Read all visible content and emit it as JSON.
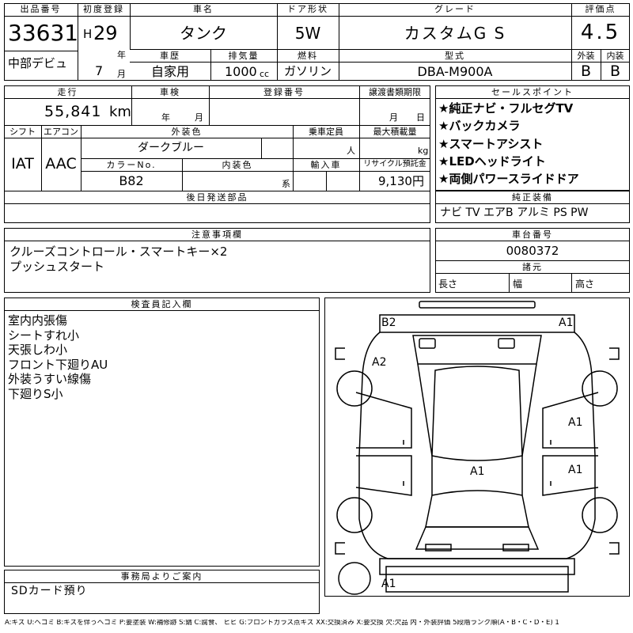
{
  "header": {
    "lot_label": "出品番号",
    "lot_no": "33631",
    "venue": "中部デビュ",
    "first_reg_label": "初度登録",
    "era": "H",
    "year": "29",
    "year_unit": "年",
    "month": "7",
    "month_unit": "月",
    "car_name_label": "車名",
    "car_name": "タンク",
    "door_label": "ドア形状",
    "door": "5W",
    "grade_label": "グレード",
    "grade": "カスタムG S",
    "score_label": "評価点",
    "score": "4.5",
    "history_label": "車歴",
    "history": "自家用",
    "displacement_label": "排気量",
    "displacement": "1000",
    "displacement_unit": "cc",
    "fuel_label": "燃料",
    "fuel": "ガソリン",
    "model_label": "型式",
    "model": "DBA-M900A",
    "exterior_label": "外装",
    "exterior": "B",
    "interior_label": "内装",
    "interior": "B"
  },
  "row2": {
    "mileage_label": "走行",
    "mileage": "55,841",
    "mileage_unit": "km",
    "inspection_label": "車検",
    "year_unit": "年",
    "month_unit": "月",
    "reg_no_label": "登録番号",
    "transfer_label": "譲渡書類期限",
    "month_unit2": "月",
    "day_unit": "日",
    "shift_label": "シフト",
    "shift": "IAT",
    "ac_label": "エアコン",
    "ac": "AAC",
    "ext_color_label": "外装色",
    "ext_color": "ダークブルー",
    "capacity_label": "乗車定員",
    "capacity_unit": "人",
    "load_label": "最大積載量",
    "load_unit": "kg",
    "color_no_label": "カラーNo.",
    "color_no": "B82",
    "int_color_label": "内装色",
    "int_color_unit": "系",
    "import_label": "輸入車",
    "recycle_label": "リサイクル預託金",
    "recycle": "9,130円",
    "later_parts_label": "後日発送部品"
  },
  "sales_points": {
    "label": "セールスポイント",
    "items": [
      "★純正ナビ・フルセグTV",
      "★バックカメラ",
      "★スマートアシスト",
      "★LEDヘッドライト",
      "★両側パワースライドドア"
    ]
  },
  "equipment": {
    "label": "純正装備",
    "value": "ナビ TV エアB アルミ PS PW"
  },
  "notes": {
    "label": "注意事項欄",
    "lines": [
      "クルーズコントロール・スマートキー×2",
      "プッシュスタート"
    ]
  },
  "chassis": {
    "label": "車台番号",
    "value": "0080372",
    "spec_label": "諸元",
    "length": "長さ",
    "width": "幅",
    "height": "高さ"
  },
  "inspector": {
    "label": "検査員記入欄",
    "lines": [
      "室内内張傷",
      "シートすれ小",
      "天張しわ小",
      "フロント下廻りAU",
      "外装うすい線傷",
      "下廻りS小"
    ]
  },
  "diagram": {
    "marks": [
      "B2",
      "A1",
      "A2",
      "A1",
      "A1",
      "A1",
      "A1"
    ]
  },
  "office": {
    "label": "事務局よりご案内",
    "text": "SDカード預り"
  },
  "legend": "A:キズ U:ヘコミ B:キズを伴うヘコミ P:要塗装 W:補修跡 S:錆 C:腐食、 ヒビ G:フロントガラス点キズ XX:交換済み X:要交換 欠:欠品 内・外装評価 5段階ランク順(A・B・C・D・E) 1"
}
